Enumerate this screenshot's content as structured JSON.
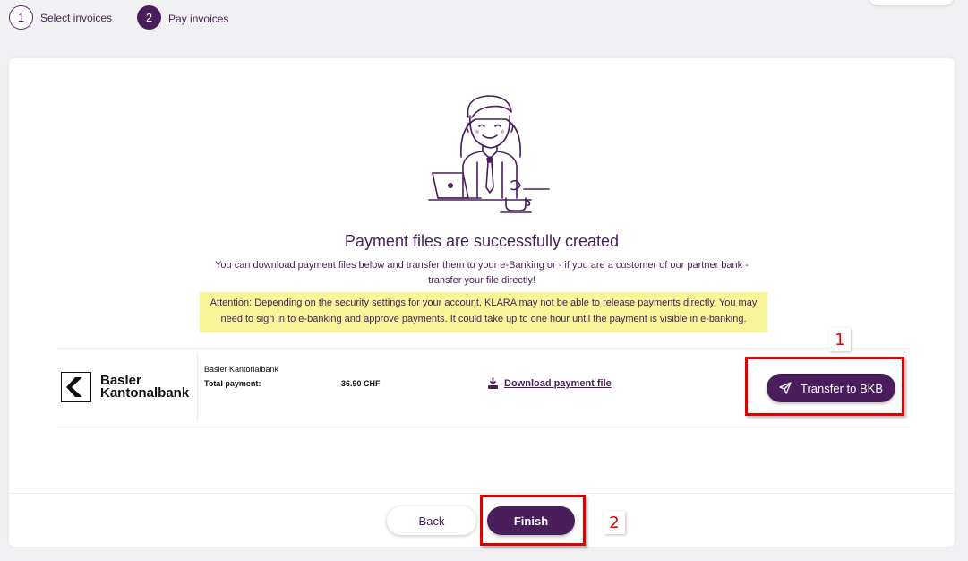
{
  "stepper": {
    "steps": [
      {
        "number": "1",
        "label": "Select invoices"
      },
      {
        "number": "2",
        "label": "Pay invoices"
      }
    ]
  },
  "main": {
    "title": "Payment files are successfully created",
    "subtitle_line1": "You can download payment files below and transfer them to your e-Banking or - if you are a customer of our partner bank -",
    "subtitle_line2": "transfer your file directly!",
    "attention_line1": "Attention: Depending on the security settings for your account, KLARA may not be able to release payments directly. You may",
    "attention_line2": "need to sign in to e-banking and approve payments. It could take up to one hour until the payment is visible in e-banking."
  },
  "bank_row": {
    "logo_line1": "Basler",
    "logo_line2": "Kantonalbank",
    "bank_name": "Basler Kantonalbank",
    "payment_label": "Total payment:",
    "payment_amount": "36.90 CHF",
    "download_label": "Download payment file",
    "transfer_label": "Transfer to BKB"
  },
  "footer": {
    "back_label": "Back",
    "finish_label": "Finish"
  },
  "annotations": {
    "first": "1",
    "second": "2"
  },
  "colors": {
    "brand": "#4a1d5c",
    "attention_bg": "#f7f59a",
    "annotation": "#e00000"
  },
  "icons": [
    "bank-logo-icon",
    "download-icon",
    "paper-plane-icon",
    "illustration-person-at-laptop"
  ]
}
